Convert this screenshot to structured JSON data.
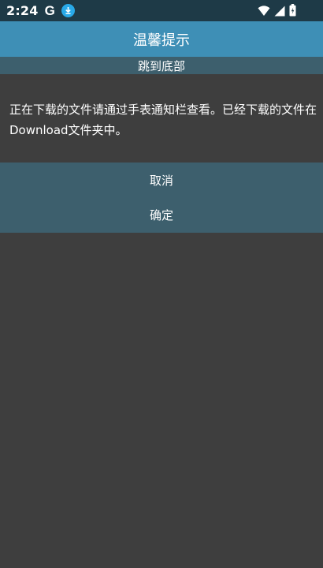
{
  "status_bar": {
    "time": "2:24",
    "g_glyph": "G",
    "icons": [
      "download-icon",
      "wifi-icon",
      "signal-icon",
      "battery-icon"
    ]
  },
  "dialog": {
    "title": "温馨提示",
    "jump_label": "跳到底部",
    "message": "正在下载的文件请通过手表通知栏查看。已经下载的文件在Download文件夹中。",
    "cancel_label": "取消",
    "confirm_label": "确定"
  },
  "colors": {
    "status_bar": "#1e3a47",
    "title_bar": "#3e8fb6",
    "accent_bar": "#3d5f6d",
    "background": "#3e3e3e",
    "download_badge": "#29a9e8"
  }
}
